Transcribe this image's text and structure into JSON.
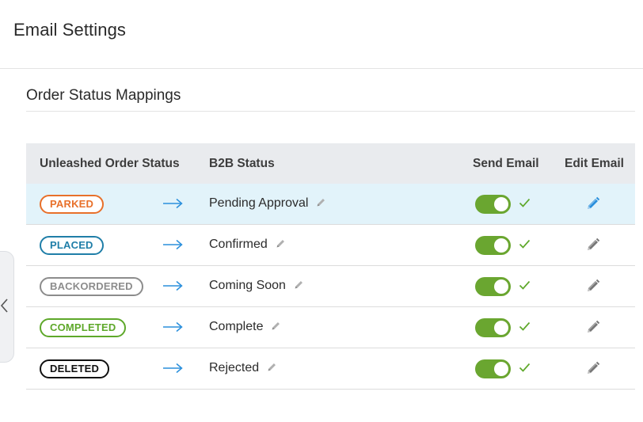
{
  "header": {
    "title": "Email Settings"
  },
  "section": {
    "title": "Order Status Mappings"
  },
  "table": {
    "headers": [
      "Unleashed Order Status",
      "B2B Status",
      "Send Email",
      "Edit Email"
    ],
    "rows": [
      {
        "status": "PARKED",
        "status_color": "#e8702a",
        "b2b": "Pending Approval",
        "send_email": true,
        "edit_icon_color": "#2a8fdc",
        "highlighted": true
      },
      {
        "status": "PLACED",
        "status_color": "#1f7ea8",
        "b2b": "Confirmed",
        "send_email": true,
        "edit_icon_color": "#777777",
        "highlighted": false
      },
      {
        "status": "BACKORDERED",
        "status_color": "#8c8c8c",
        "b2b": "Coming Soon",
        "send_email": true,
        "edit_icon_color": "#777777",
        "highlighted": false
      },
      {
        "status": "COMPLETED",
        "status_color": "#5ea82a",
        "b2b": "Complete",
        "send_email": true,
        "edit_icon_color": "#777777",
        "highlighted": false
      },
      {
        "status": "DELETED",
        "status_color": "#111111",
        "b2b": "Rejected",
        "send_email": true,
        "edit_icon_color": "#777777",
        "highlighted": false
      }
    ]
  },
  "colors": {
    "toggle_on": "#6aa630",
    "check": "#5ea82a",
    "arrow": "#2a8fdc",
    "highlight_row": "#e2f3fa"
  }
}
